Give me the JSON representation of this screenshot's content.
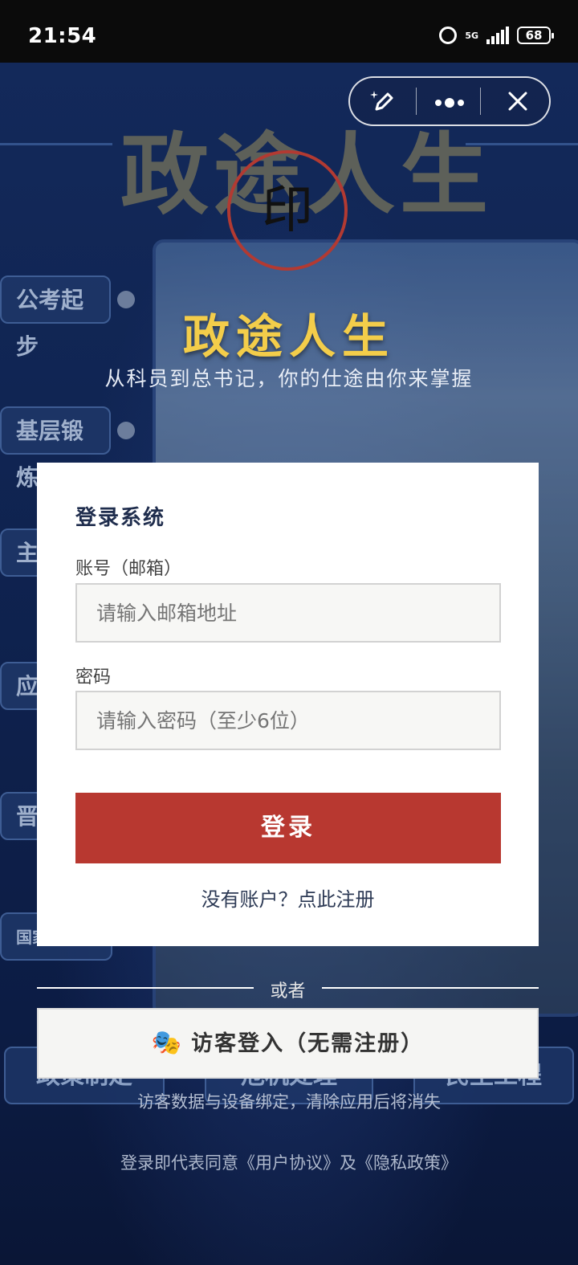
{
  "status_bar": {
    "time": "21:54",
    "network": "5G",
    "battery": "68"
  },
  "background": {
    "title_text": "政途人生",
    "sidebar_items": [
      "公考起步",
      "基层锻炼",
      "主",
      "应",
      "晋",
      "国家"
    ],
    "bottom_buttons": [
      "政策制定",
      "危机处理",
      "民生工程"
    ]
  },
  "mini_toolbar": {
    "edit_icon": "sparkle-pen-icon",
    "more_icon": "more-dots-icon",
    "close_icon": "close-icon"
  },
  "seal": {
    "text": "印",
    "color": "#b23a32"
  },
  "header": {
    "title": "政途人生",
    "subtitle": "从科员到总书记，你的仕途由你来掌握",
    "title_color": "#f3cd4a"
  },
  "login": {
    "title": "登录系统",
    "account_label": "账号（邮箱）",
    "account_placeholder": "请输入邮箱地址",
    "password_label": "密码",
    "password_placeholder": "请输入密码（至少6位）",
    "login_button": "登录",
    "register_link": "没有账户？点此注册",
    "button_color": "#b83830"
  },
  "divider_text": "或者",
  "guest": {
    "icon": "🎭",
    "label": "访客登入（无需注册）",
    "note": "访客数据与设备绑定，清除应用后将消失"
  },
  "agreement": "登录即代表同意《用户协议》及《隐私政策》"
}
